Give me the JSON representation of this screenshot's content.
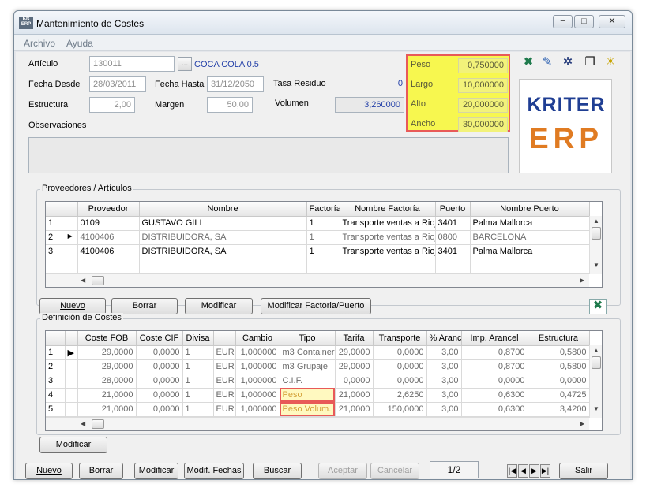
{
  "window": {
    "title": "Mantenimiento de Costes",
    "app_icon": "KR ERP",
    "minimize": "−",
    "maximize": "□",
    "close": "✕"
  },
  "menu": [
    "Archivo",
    "Ayuda"
  ],
  "header": {
    "articulo_label": "Artículo",
    "articulo_value": "130011",
    "articulo_desc": "COCA COLA 0.5",
    "lookup_label": "...",
    "fecha_desde_label": "Fecha Desde",
    "fecha_desde_value": "28/03/2011",
    "fecha_hasta_label": "Fecha Hasta",
    "fecha_hasta_value": "31/12/2050",
    "tasa_residuo_label": "Tasa Residuo",
    "tasa_residuo_value": "0",
    "estructura_label": "Estructura",
    "estructura_value": "2,00",
    "margen_label": "Margen",
    "margen_value": "50,00",
    "volumen_label": "Volumen",
    "volumen_value": "3,260000",
    "observaciones_label": "Observaciones",
    "observaciones_value": ""
  },
  "dims": [
    {
      "label": "Peso",
      "value": "0,750000"
    },
    {
      "label": "Largo",
      "value": "10,000000"
    },
    {
      "label": "Alto",
      "value": "20,000000"
    },
    {
      "label": "Ancho",
      "value": "30,000000"
    }
  ],
  "toolbar_icons": [
    "excel-icon",
    "pencil-icon",
    "network-icon",
    "windows-icon",
    "lightbulb-icon"
  ],
  "logo": {
    "line1": "KRITER",
    "line2": "ERP"
  },
  "proveedores": {
    "title": "Proveedores / Artículos",
    "columns": [
      "",
      "Proveedor",
      "Nombre",
      "Factoría",
      "Nombre Factoría",
      "Puerto",
      "Nombre Puerto"
    ],
    "rows": [
      {
        "n": "1",
        "ind": "",
        "proveedor": "0109",
        "nombre": "GUSTAVO GILI",
        "factoria": "1",
        "nombre_factoria": "Transporte ventas a Rioja",
        "puerto": "3401",
        "nombre_puerto": "Palma Mallorca",
        "grey": false
      },
      {
        "n": "2",
        "ind": "▶·",
        "proveedor": "4100406",
        "nombre": "DISTRIBUIDORA, SA",
        "factoria": "1",
        "nombre_factoria": "Transporte ventas a Rioja",
        "puerto": "0800",
        "nombre_puerto": "BARCELONA",
        "grey": true
      },
      {
        "n": "3",
        "ind": "",
        "proveedor": "4100406",
        "nombre": "DISTRIBUIDORA, SA",
        "factoria": "1",
        "nombre_factoria": "Transporte ventas a Rioja",
        "puerto": "3401",
        "nombre_puerto": "Palma Mallorca",
        "grey": false
      }
    ],
    "buttons": [
      "Nuevo",
      "Borrar",
      "Modificar",
      "Modificar Factoria/Puerto"
    ]
  },
  "costes": {
    "title": "Definición de Costes",
    "columns": [
      "",
      "",
      "Coste FOB",
      "Coste CIF",
      "Divisa",
      "",
      "Cambio",
      "Tipo",
      "Tarifa",
      "Transporte",
      "% Arancel",
      "Imp. Arancel",
      "Estructura"
    ],
    "rows": [
      {
        "n": "1",
        "ind": "▶",
        "fob": "29,0000",
        "cif": "0,0000",
        "divisa": "1",
        "moneda": "EUR",
        "cambio": "1,000000",
        "tipo": "m3 Container",
        "tarifa": "29,0000",
        "transporte": "0,0000",
        "arancel": "3,00",
        "imp_arancel": "0,8700",
        "estructura": "0,5800",
        "hl": false
      },
      {
        "n": "2",
        "ind": "",
        "fob": "29,0000",
        "cif": "0,0000",
        "divisa": "1",
        "moneda": "EUR",
        "cambio": "1,000000",
        "tipo": "m3 Grupaje",
        "tarifa": "29,0000",
        "transporte": "0,0000",
        "arancel": "3,00",
        "imp_arancel": "0,8700",
        "estructura": "0,5800",
        "hl": false
      },
      {
        "n": "3",
        "ind": "",
        "fob": "28,0000",
        "cif": "0,0000",
        "divisa": "1",
        "moneda": "EUR",
        "cambio": "1,000000",
        "tipo": "C.I.F.",
        "tarifa": "0,0000",
        "transporte": "0,0000",
        "arancel": "3,00",
        "imp_arancel": "0,0000",
        "estructura": "0,0000",
        "hl": false
      },
      {
        "n": "4",
        "ind": "",
        "fob": "21,0000",
        "cif": "0,0000",
        "divisa": "1",
        "moneda": "EUR",
        "cambio": "1,000000",
        "tipo": "Peso",
        "tarifa": "21,0000",
        "transporte": "2,6250",
        "arancel": "3,00",
        "imp_arancel": "0,6300",
        "estructura": "0,4725",
        "hl": true
      },
      {
        "n": "5",
        "ind": "",
        "fob": "21,0000",
        "cif": "0,0000",
        "divisa": "1",
        "moneda": "EUR",
        "cambio": "1,000000",
        "tipo": "Peso Volum.",
        "tarifa": "21,0000",
        "transporte": "150,0000",
        "arancel": "3,00",
        "imp_arancel": "0,6300",
        "estructura": "3,4200",
        "hl": true
      }
    ],
    "modificar": "Modificar"
  },
  "bottom": {
    "nuevo": "Nuevo",
    "borrar": "Borrar",
    "modificar": "Modificar",
    "modif_fechas": "Modif. Fechas",
    "buscar": "Buscar",
    "aceptar": "Aceptar",
    "cancelar": "Cancelar",
    "page": "1/2",
    "salir": "Salir",
    "nav": [
      "|◀",
      "◀",
      "▶",
      "▶|"
    ]
  },
  "colors": {
    "highlight_yellow": "#f7f74f",
    "highlight_border": "#e85a58",
    "logo_blue": "#1f3e93",
    "logo_orange": "#e07b22"
  }
}
